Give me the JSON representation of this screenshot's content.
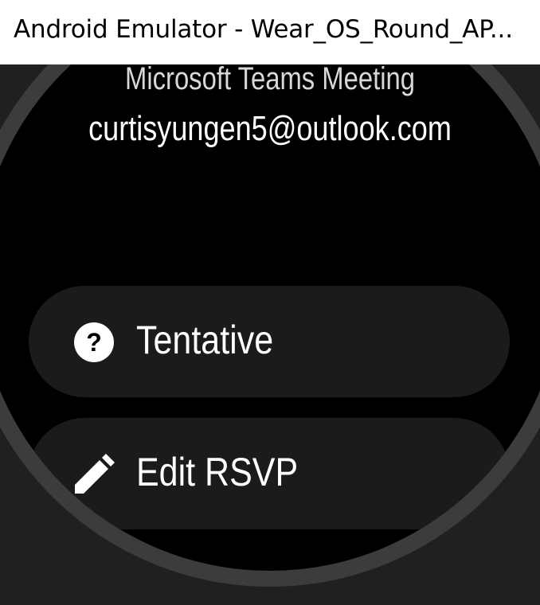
{
  "window": {
    "title": "Android Emulator - Wear_OS_Round_AP..."
  },
  "watch": {
    "organizer_name": "Microsoft Teams Meeting",
    "organizer_email": "curtisyungen5@outlook.com",
    "actions": [
      {
        "label": "Tentative",
        "icon": "question-circle-icon"
      },
      {
        "label": "Edit RSVP",
        "icon": "pencil-icon"
      }
    ],
    "colors": {
      "screen_background": "#000000",
      "bezel": "#3c3c3c",
      "chip_background": "#1b1b1b",
      "text": "#ffffff",
      "emulator_frame": "#202020"
    }
  }
}
